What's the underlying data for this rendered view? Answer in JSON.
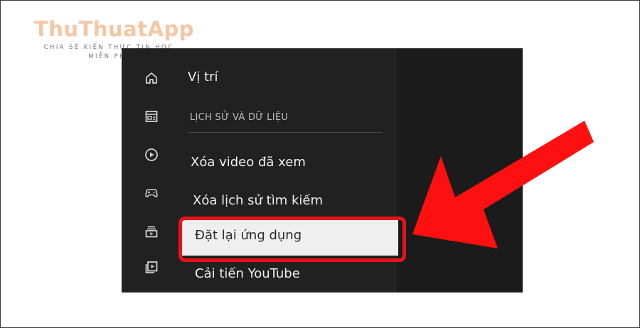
{
  "watermark": {
    "title": "ThuThuatApp",
    "tagline_line1": "CHIA SẺ KIẾN THỨC TIN HỌC",
    "tagline_line2": "MIỄN PHÍ"
  },
  "settings_screen": {
    "rail_icons": [
      "home-icon",
      "subscriptions-icon",
      "play-icon",
      "gaming-icon",
      "library-icon",
      "video-library-icon"
    ],
    "items": {
      "location": "Vị trí",
      "section_header": "LỊCH SỬ VÀ DỮ LIỆU",
      "clear_watch_history": "Xóa video đã xem",
      "clear_search_history": "Xóa lịch sử tìm kiếm",
      "reset_app": "Đặt lại ứng dụng",
      "improve_youtube": "Cải tiến YouTube"
    }
  },
  "annotation": {
    "highlight_color": "#e8141b",
    "arrow_color": "#ff1010"
  }
}
